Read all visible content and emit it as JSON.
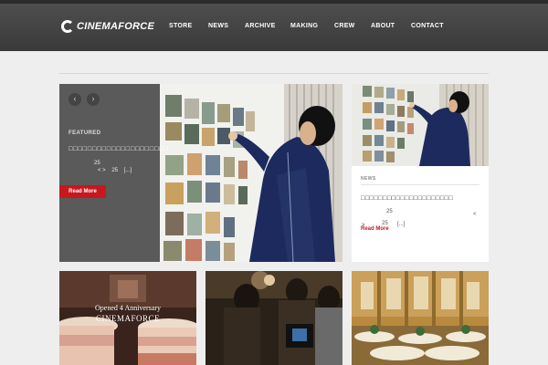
{
  "header": {
    "logo_text": "CINEMAFORCE",
    "nav": [
      "STORE",
      "NEWS",
      "ARCHIVE",
      "MAKING",
      "CREW",
      "ABOUT",
      "CONTACT"
    ]
  },
  "slider": {
    "prev_icon": "‹",
    "next_icon": "›",
    "label": "FEATURED",
    "title": "□□□□□□□□□□□□□□□□□□□□□",
    "meta_line1": "25",
    "meta_line2": "< >    25    [...]",
    "button_label": "Read More"
  },
  "card_right": {
    "label": "NEWS",
    "title": "□□□□□□□□□□□□□□□□□□□□□",
    "meta_num": "25",
    "meta_lt": "<",
    "meta_gt": ">",
    "meta_num2": "25",
    "meta_ellipsis": "[...]",
    "read_more": "Read More"
  },
  "thumbs": [
    {
      "line1": "Opened 4 Anniversary",
      "line2": "CINEMAFORCE"
    },
    {
      "line1": "",
      "line2": ""
    },
    {
      "line1": "",
      "line2": ""
    }
  ],
  "colors": {
    "accent": "#c8171e",
    "header": "#444444",
    "page_bg": "#eeeeee"
  }
}
